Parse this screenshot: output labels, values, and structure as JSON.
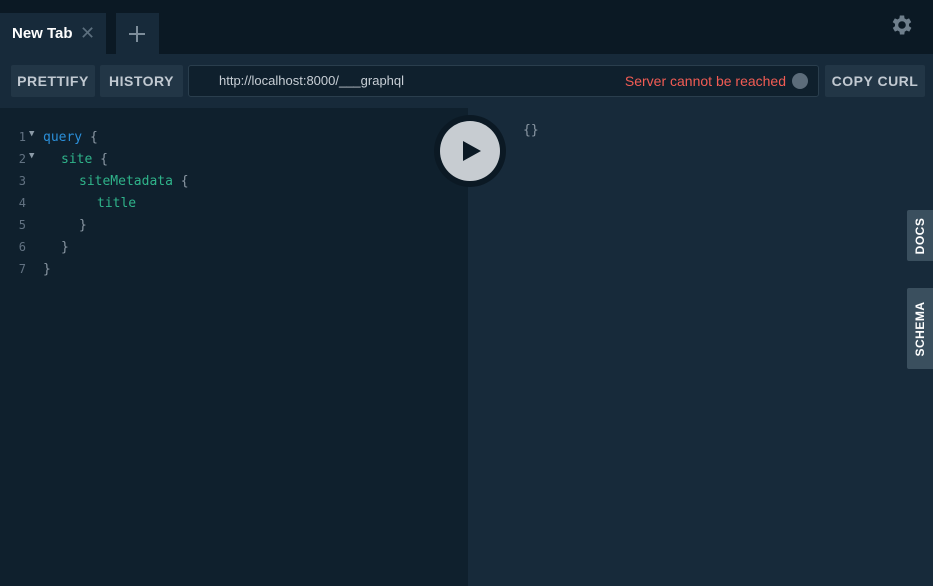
{
  "tabs": [
    {
      "label": "New Tab",
      "close_glyph": "✕"
    }
  ],
  "add_tab_icon": "plus-icon",
  "settings_icon": "gear-icon",
  "toolbar": {
    "prettify_label": "PRETTIFY",
    "history_label": "HISTORY",
    "endpoint_url": "http://localhost:8000/___graphql",
    "server_status": "Server cannot be reached",
    "copy_curl_label": "COPY CURL"
  },
  "editor": {
    "lines": [
      {
        "num": "1",
        "text": "query",
        "open": "{"
      },
      {
        "num": "2",
        "text": "site",
        "open": "{"
      },
      {
        "num": "3",
        "text": "siteMetadata",
        "open": "{"
      },
      {
        "num": "4",
        "text": "title"
      },
      {
        "num": "5",
        "close": "}"
      },
      {
        "num": "6",
        "close": "}"
      },
      {
        "num": "7",
        "close": "}"
      }
    ]
  },
  "run_icon": "play-icon",
  "result": {
    "text": "{}"
  },
  "side_tabs": {
    "docs": "DOCS",
    "schema": "SCHEMA"
  },
  "colors": {
    "background": "#0f202d",
    "panel": "#172a3a",
    "keyword": "#2b8fd9",
    "field": "#2fb38a",
    "error": "#f25c54"
  }
}
